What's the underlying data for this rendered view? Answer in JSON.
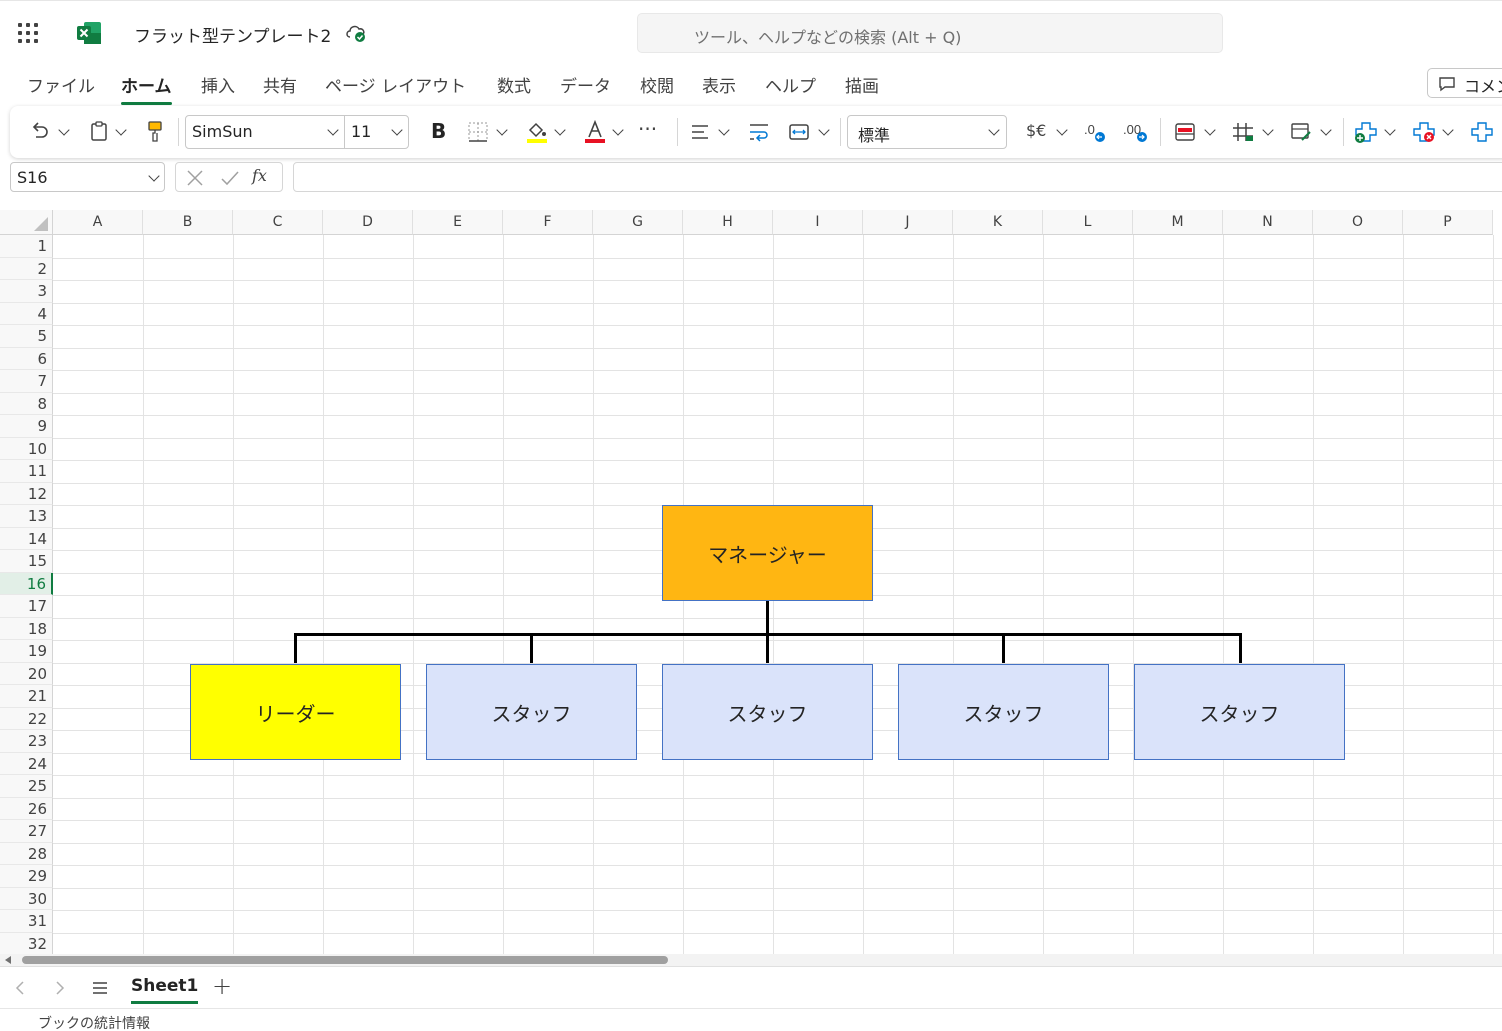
{
  "titlebar": {
    "doc_title": "フラット型テンプレート2",
    "search_placeholder": "ツール、ヘルプなどの検索 (Alt + Q)"
  },
  "menu": {
    "tabs": [
      "ファイル",
      "ホーム",
      "挿入",
      "共有",
      "ページ レイアウト",
      "数式",
      "データ",
      "校閲",
      "表示",
      "ヘルプ",
      "描画"
    ],
    "active": "ホーム",
    "comment_label": "コメン"
  },
  "ribbon": {
    "font_name": "SimSun",
    "font_size": "11",
    "number_format": "標準",
    "bold_label": "B",
    "currency_label": "$€",
    "more_label": "···"
  },
  "formula_bar": {
    "name_box": "S16",
    "fx_label": "fx",
    "formula": ""
  },
  "grid": {
    "columns": [
      "A",
      "B",
      "C",
      "D",
      "E",
      "F",
      "G",
      "H",
      "I",
      "J",
      "K",
      "L",
      "M",
      "N",
      "O",
      "P"
    ],
    "rows": [
      "1",
      "2",
      "3",
      "4",
      "5",
      "6",
      "7",
      "8",
      "9",
      "10",
      "11",
      "12",
      "13",
      "14",
      "15",
      "16",
      "17",
      "18",
      "19",
      "20",
      "21",
      "22",
      "23",
      "24",
      "25",
      "26",
      "27",
      "28",
      "29",
      "30",
      "31",
      "32"
    ],
    "selected_row": "16"
  },
  "org_chart": {
    "manager": {
      "label": "マネージャー",
      "color": "#ffb612"
    },
    "leader": {
      "label": "リーダー",
      "color": "#ffff00"
    },
    "staff": [
      {
        "label": "スタッフ",
        "color": "#dae3fa"
      },
      {
        "label": "スタッフ",
        "color": "#dae3fa"
      },
      {
        "label": "スタッフ",
        "color": "#dae3fa"
      },
      {
        "label": "スタッフ",
        "color": "#dae3fa"
      }
    ]
  },
  "sheets": {
    "tabs": [
      "Sheet1"
    ],
    "active": "Sheet1",
    "add_label": "+"
  },
  "status": {
    "stats_label": "ブックの統計情報"
  },
  "colors": {
    "accent": "#107c41",
    "shape_border": "#4472c4"
  }
}
